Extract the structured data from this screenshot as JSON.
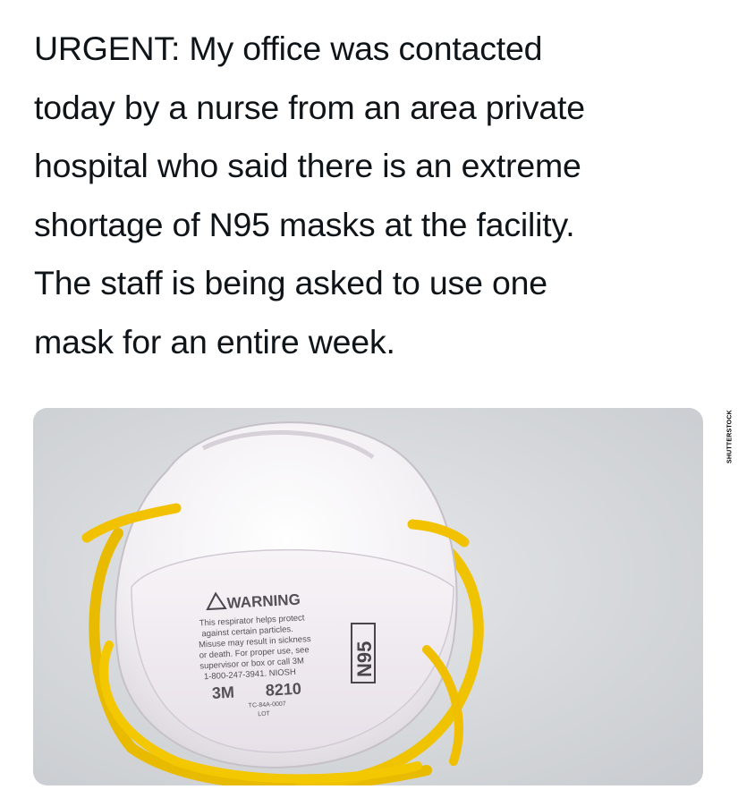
{
  "tweet": {
    "text_lines": [
      "URGENT: My office was contacted",
      "today by a nurse from an area private",
      "hospital who said there is an extreme",
      "shortage of N95 masks at the facility.",
      "The staff is being asked to use one",
      "mask for an entire week."
    ]
  },
  "media": {
    "watermark": "SHUTTERSTOCK",
    "mask_print": {
      "warning": "WARNING",
      "lines": [
        "This respirator helps protect",
        "against certain particles.",
        "Misuse may result in sickness",
        "or death. For proper use, see",
        "supervisor or box or call 3M",
        "1-800-247-3941. NIOSH"
      ],
      "brand": "3M",
      "model": "8210",
      "rating": "N95",
      "approval": "TC-84A-0007",
      "lot": "LOT"
    }
  },
  "colors": {
    "background": "#ffffff",
    "text": "#0f1419",
    "mask_white": "#f4f3f5",
    "strap_yellow": "#f2c200",
    "surface": "#d9dbde"
  }
}
